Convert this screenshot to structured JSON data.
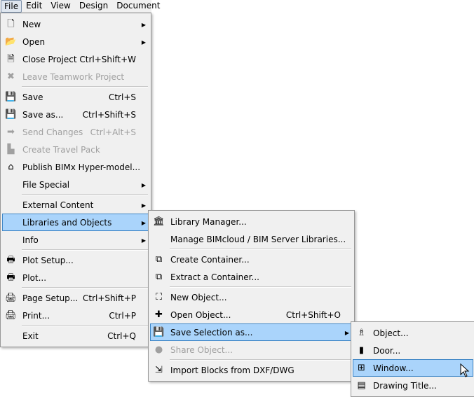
{
  "menubar": [
    "File",
    "Edit",
    "View",
    "Design",
    "Document"
  ],
  "file_menu": [
    {
      "label": "New",
      "icon": "new-document-icon",
      "glyph": "🗋",
      "arrow": true
    },
    {
      "label": "Open",
      "icon": "open-folder-icon",
      "glyph": "📂",
      "arrow": true
    },
    {
      "label": "Close Project",
      "icon": "close-project-icon",
      "glyph": "🗎",
      "shortcut": "Ctrl+Shift+W"
    },
    {
      "label": "Leave Teamwork Project",
      "icon": "leave-teamwork-icon",
      "glyph": "✖",
      "disabled": true
    },
    {
      "sep": true
    },
    {
      "label": "Save",
      "icon": "save-icon",
      "glyph": "💾",
      "shortcut": "Ctrl+S"
    },
    {
      "label": "Save as...",
      "icon": "save-as-icon",
      "glyph": "💾",
      "shortcut": "Ctrl+Shift+S"
    },
    {
      "label": "Send Changes",
      "icon": "send-changes-icon",
      "glyph": "➡",
      "shortcut": "Ctrl+Alt+S",
      "disabled": true
    },
    {
      "label": "Create Travel Pack",
      "icon": "travel-pack-icon",
      "glyph": "▙",
      "disabled": true
    },
    {
      "label": "Publish BIMx Hyper-model...",
      "icon": "publish-bimx-icon",
      "glyph": "⌂"
    },
    {
      "label": "File Special",
      "arrow": true
    },
    {
      "sep": true
    },
    {
      "label": "External Content",
      "arrow": true
    },
    {
      "label": "Libraries and Objects",
      "arrow": true,
      "highlighted": true
    },
    {
      "label": "Info",
      "arrow": true
    },
    {
      "sep": true
    },
    {
      "label": "Plot Setup...",
      "icon": "plot-setup-icon",
      "glyph": "🖶"
    },
    {
      "label": "Plot...",
      "icon": "plot-icon",
      "glyph": "🖶"
    },
    {
      "sep": true
    },
    {
      "label": "Page Setup...",
      "icon": "page-setup-icon",
      "glyph": "🖨",
      "shortcut": "Ctrl+Shift+P"
    },
    {
      "label": "Print...",
      "icon": "print-icon",
      "glyph": "🖨",
      "shortcut": "Ctrl+P"
    },
    {
      "sep": true
    },
    {
      "label": "Exit",
      "shortcut": "Ctrl+Q"
    }
  ],
  "libraries_menu": [
    {
      "label": "Library Manager...",
      "icon": "library-manager-icon",
      "glyph": "🏛"
    },
    {
      "label": "Manage BIMcloud / BIM Server Libraries..."
    },
    {
      "sep": true
    },
    {
      "label": "Create Container...",
      "icon": "create-container-icon",
      "glyph": "⧉"
    },
    {
      "label": "Extract a Container...",
      "icon": "extract-container-icon",
      "glyph": "⧉"
    },
    {
      "sep": true
    },
    {
      "label": "New Object...",
      "icon": "new-object-icon",
      "glyph": "⛶"
    },
    {
      "label": "Open Object...",
      "icon": "open-object-icon",
      "glyph": "✚",
      "shortcut": "Ctrl+Shift+O"
    },
    {
      "label": "Save Selection as...",
      "icon": "save-selection-icon",
      "glyph": "💾",
      "arrow": true,
      "highlighted": true
    },
    {
      "label": "Share Object...",
      "icon": "share-object-icon",
      "glyph": "●",
      "disabled": true
    },
    {
      "sep": true
    },
    {
      "label": "Import Blocks from DXF/DWG",
      "icon": "import-blocks-icon",
      "glyph": "⇲"
    }
  ],
  "save_selection_menu": [
    {
      "label": "Object...",
      "icon": "object-chair-icon",
      "glyph": "♗"
    },
    {
      "label": "Door...",
      "icon": "door-icon",
      "glyph": "▮"
    },
    {
      "label": "Window...",
      "icon": "window-icon",
      "glyph": "⊞",
      "highlighted": true
    },
    {
      "label": "Drawing Title...",
      "icon": "drawing-title-icon",
      "glyph": "▤"
    }
  ]
}
